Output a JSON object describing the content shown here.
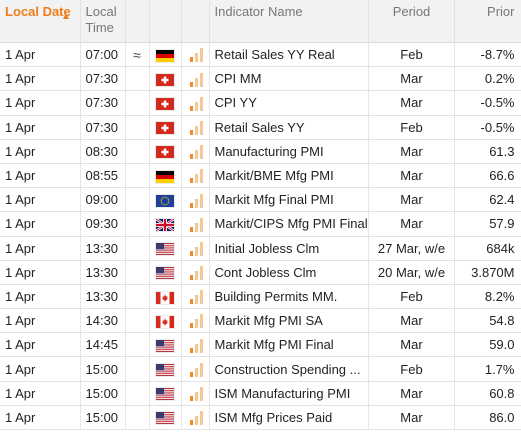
{
  "header": {
    "local_date": "Local Date",
    "sort_arrow": "▲",
    "local_time": "Local Time",
    "indicator_name": "Indicator Name",
    "period": "Period",
    "prior": "Prior"
  },
  "colors": {
    "accent": "#ee7d1b",
    "bar_active": "#ee8a2a",
    "bar_inactive": "#f5c793"
  },
  "rows": [
    {
      "date": "1 Apr",
      "time": "07:00",
      "vol": "≈",
      "country": "DE",
      "importance": 1,
      "name": "Retail Sales YY Real",
      "period": "Feb",
      "prior": "-8.7%"
    },
    {
      "date": "1 Apr",
      "time": "07:30",
      "vol": "",
      "country": "CH",
      "importance": 1,
      "name": "CPI MM",
      "period": "Mar",
      "prior": "0.2%"
    },
    {
      "date": "1 Apr",
      "time": "07:30",
      "vol": "",
      "country": "CH",
      "importance": 1,
      "name": "CPI YY",
      "period": "Mar",
      "prior": "-0.5%"
    },
    {
      "date": "1 Apr",
      "time": "07:30",
      "vol": "",
      "country": "CH",
      "importance": 1,
      "name": "Retail Sales YY",
      "period": "Feb",
      "prior": "-0.5%"
    },
    {
      "date": "1 Apr",
      "time": "08:30",
      "vol": "",
      "country": "CH",
      "importance": 1,
      "name": "Manufacturing PMI",
      "period": "Mar",
      "prior": "61.3"
    },
    {
      "date": "1 Apr",
      "time": "08:55",
      "vol": "",
      "country": "DE",
      "importance": 1,
      "name": "Markit/BME Mfg PMI",
      "period": "Mar",
      "prior": "66.6"
    },
    {
      "date": "1 Apr",
      "time": "09:00",
      "vol": "",
      "country": "EU",
      "importance": 1,
      "name": "Markit Mfg Final PMI",
      "period": "Mar",
      "prior": "62.4"
    },
    {
      "date": "1 Apr",
      "time": "09:30",
      "vol": "",
      "country": "GB",
      "importance": 1,
      "name": "Markit/CIPS Mfg PMI Final",
      "period": "Mar",
      "prior": "57.9"
    },
    {
      "date": "1 Apr",
      "time": "13:30",
      "vol": "",
      "country": "US",
      "importance": 1,
      "name": "Initial Jobless Clm",
      "period": "27 Mar, w/e",
      "prior": "684k"
    },
    {
      "date": "1 Apr",
      "time": "13:30",
      "vol": "",
      "country": "US",
      "importance": 1,
      "name": "Cont Jobless Clm",
      "period": "20 Mar, w/e",
      "prior": "3.870M"
    },
    {
      "date": "1 Apr",
      "time": "13:30",
      "vol": "",
      "country": "CA",
      "importance": 1,
      "name": "Building Permits MM.",
      "period": "Feb",
      "prior": "8.2%"
    },
    {
      "date": "1 Apr",
      "time": "14:30",
      "vol": "",
      "country": "CA",
      "importance": 1,
      "name": "Markit Mfg PMI SA",
      "period": "Mar",
      "prior": "54.8"
    },
    {
      "date": "1 Apr",
      "time": "14:45",
      "vol": "",
      "country": "US",
      "importance": 1,
      "name": "Markit Mfg PMI Final",
      "period": "Mar",
      "prior": "59.0"
    },
    {
      "date": "1 Apr",
      "time": "15:00",
      "vol": "",
      "country": "US",
      "importance": 1,
      "name": "Construction Spending ...",
      "period": "Feb",
      "prior": "1.7%"
    },
    {
      "date": "1 Apr",
      "time": "15:00",
      "vol": "",
      "country": "US",
      "importance": 1,
      "name": "ISM Manufacturing PMI",
      "period": "Mar",
      "prior": "60.8"
    },
    {
      "date": "1 Apr",
      "time": "15:00",
      "vol": "",
      "country": "US",
      "importance": 1,
      "name": "ISM Mfg Prices Paid",
      "period": "Mar",
      "prior": "86.0"
    }
  ]
}
